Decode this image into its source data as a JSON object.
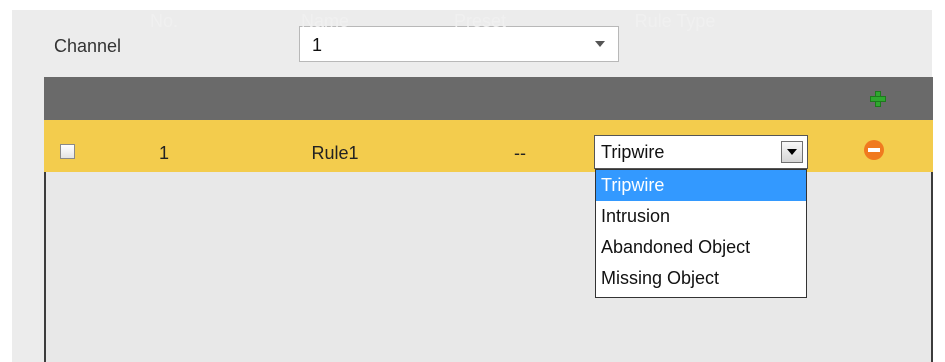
{
  "channel": {
    "label": "Channel",
    "selected": "1"
  },
  "table": {
    "headers": {
      "no": "No.",
      "name": "Name",
      "preset": "Preset",
      "rule_type": "Rule Type"
    },
    "rows": [
      {
        "no": "1",
        "name": "Rule1",
        "preset": "--",
        "rule_type": "Tripwire",
        "checked": false
      }
    ]
  },
  "rule_type_dropdown": {
    "options": [
      "Tripwire",
      "Intrusion",
      "Abandoned Object",
      "Missing Object"
    ],
    "highlighted": "Tripwire"
  },
  "colors": {
    "header_bg": "#6a6a6a",
    "selected_row_bg": "#f3cc4d",
    "add_icon": "#2fa82f",
    "delete_icon": "#f07a1f",
    "dropdown_highlight": "#3399ff"
  }
}
